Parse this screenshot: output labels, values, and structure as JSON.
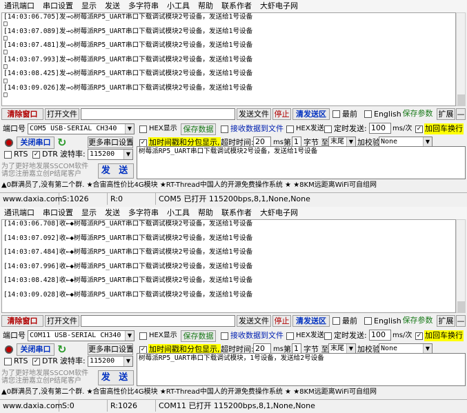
{
  "menu": [
    "通讯端口",
    "串口设置",
    "显示",
    "发送",
    "多字符串",
    "小工具",
    "帮助",
    "联系作者",
    "大虾电子网"
  ],
  "windows": [
    {
      "log": [
        "[14:03:06.705]发→◇树莓派RP5_UART串口下载调试模块2号设备，发送给1号设备",
        "[14:03:07.089]发→◇树莓派RP5_UART串口下载调试模块2号设备，发送给1号设备",
        "[14:03:07.481]发→◇树莓派RP5_UART串口下载调试模块2号设备，发送给1号设备",
        "[14:03:07.993]发→◇树莓派RP5_UART串口下载调试模块2号设备，发送给1号设备",
        "[14:03:08.425]发→◇树莓派RP5_UART串口下载调试模块2号设备，发送给1号设备",
        "[14:03:09.026]发→◇树莓派RP5_UART串口下载调试模块2号设备，发送给1号设备"
      ],
      "box_glyph": "□",
      "toolbar": {
        "clear": "清除窗口",
        "open_file": "打开文件",
        "send_file": "发送文件",
        "stop": "停止",
        "clear_send": "清发送区",
        "top_most": "最前",
        "english": "English",
        "save_params": "保存参数",
        "expand": "扩展",
        "minus": "—"
      },
      "port_label": "端口号",
      "port": "COM5 USB-SERIAL CH340",
      "hex_display": "HEX显示",
      "save_data": "保存数据",
      "recv_to_file": "接收数据到文件",
      "hex_send": "HEX发送",
      "timed_send": "定时发送:",
      "timed_value": "100",
      "timed_unit": "ms/次",
      "add_crlf": "加回车换行",
      "close_port": "关闭串口",
      "more_settings": "更多串口设置",
      "timestamp": "加时间戳和分包显示,",
      "timeout_label": "超时时间:",
      "timeout_value": "20",
      "ms": "ms",
      "nth": "第",
      "nth_value": "1",
      "byte_to": "字节 至",
      "tail": "末尾",
      "checksum_label": "加校验",
      "checksum": "None",
      "rts": "RTS",
      "dtr": "DTR",
      "baud_label": "波特率:",
      "baud": "115200",
      "send_text": "树莓派RP5_UART串口下载调试模块2号设备，发送给1号设备",
      "hint1": "为了更好地发展SSCOM软件",
      "hint2": "请您注册嘉立创P结尾客户",
      "send_btn": "发 送",
      "marquee": "▲0群满员了,没有第二个群. ★合宙高性价比4G模块 ★RT-Thread中国人的开源免费操作系统 ★ ★8KM远距离WiFi可自组网",
      "status": {
        "site": "www.daxia.com",
        "s": "S:1026",
        "r": "R:0",
        "port": "COM5 已打开  115200bps,8,1,None,None"
      }
    },
    {
      "log": [
        "[14:03:06.708]收←◆树莓派RP5_UART串口下载调试模块2号设备，发送给1号设备",
        "[14:03:07.092]收←◆树莓派RP5_UART串口下载调试模块2号设备，发送给1号设备",
        "[14:03:07.484]收←◆树莓派RP5_UART串口下载调试模块2号设备，发送给1号设备",
        "[14:03:07.996]收←◆树莓派RP5_UART串口下载调试模块2号设备，发送给1号设备",
        "[14:03:08.428]收←◆树莓派RP5_UART串口下载调试模块2号设备，发送给1号设备",
        "[14:03:09.028]收←◆树莓派RP5_UART串口下载调试模块2号设备，发送给1号设备"
      ],
      "box_glyph": "",
      "toolbar": {
        "clear": "清除窗口",
        "open_file": "打开文件",
        "send_file": "发送文件",
        "stop": "停止",
        "clear_send": "清发送区",
        "top_most": "最前",
        "english": "English",
        "save_params": "保存参数",
        "expand": "扩展",
        "minus": "—"
      },
      "port_label": "端口号",
      "port": "COM11 USB-SERIAL CH340",
      "hex_display": "HEX显示",
      "save_data": "保存数据",
      "recv_to_file": "接收数据到文件",
      "hex_send": "HEX发送",
      "timed_send": "定时发送:",
      "timed_value": "100",
      "timed_unit": "ms/次",
      "add_crlf": "加回车换行",
      "close_port": "关闭串口",
      "more_settings": "更多串口设置",
      "timestamp": "加时间戳和分包显示,",
      "timeout_label": "超时时间:",
      "timeout_value": "20",
      "ms": "ms",
      "nth": "第",
      "nth_value": "1",
      "byte_to": "字节 至",
      "tail": "末尾",
      "checksum_label": "加校验",
      "checksum": "None",
      "rts": "RTS",
      "dtr": "DTR",
      "baud_label": "波特率:",
      "baud": "115200",
      "send_text": "树莓派RP5_UART串口下载调试模块，1号设备，发送给2号设备",
      "hint1": "为了更好地发展SSCOM软件",
      "hint2": "请您注册嘉立创P结尾客户",
      "send_btn": "发 送",
      "marquee": "▲0群满员了,没有第二个群. ★合宙高性价比4G模块 ★RT-Thread中国人的开源免费操作系统 ★ ★8KM远距离WiFi可自组网",
      "status": {
        "site": "www.daxia.com",
        "s": "S:0",
        "r": "R:1026",
        "port": "COM11 已打开  115200bps,8,1,None,None"
      }
    }
  ]
}
